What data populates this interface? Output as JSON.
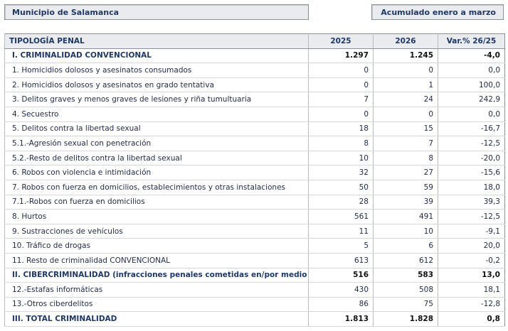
{
  "header": {
    "municipality": "Municipio de Salamanca",
    "period": "Acumulado enero a marzo"
  },
  "table": {
    "columns": [
      "TIPOLOGÍA PENAL",
      "2025",
      "2026",
      "Var.% 26/25"
    ],
    "rows": [
      {
        "label": "I. CRIMINALIDAD CONVENCIONAL",
        "y2025": "1.297",
        "y2026": "1.245",
        "var": "-4,0",
        "bold": true
      },
      {
        "label": "1. Homicidios dolosos y asesinatos consumados",
        "y2025": "0",
        "y2026": "0",
        "var": "0,0",
        "bold": false
      },
      {
        "label": "2. Homicidios dolosos y asesinatos en grado tentativa",
        "y2025": "0",
        "y2026": "1",
        "var": "100,0",
        "bold": false
      },
      {
        "label": "3. Delitos graves y menos graves de lesiones y riña tumultuaria",
        "y2025": "7",
        "y2026": "24",
        "var": "242,9",
        "bold": false
      },
      {
        "label": "4. Secuestro",
        "y2025": "0",
        "y2026": "0",
        "var": "0,0",
        "bold": false
      },
      {
        "label": "5. Delitos contra la libertad sexual",
        "y2025": "18",
        "y2026": "15",
        "var": "-16,7",
        "bold": false
      },
      {
        "label": "5.1.-Agresión sexual con penetración",
        "y2025": "8",
        "y2026": "7",
        "var": "-12,5",
        "bold": false
      },
      {
        "label": "5.2.-Resto de delitos contra la libertad sexual",
        "y2025": "10",
        "y2026": "8",
        "var": "-20,0",
        "bold": false
      },
      {
        "label": "6. Robos con violencia e intimidación",
        "y2025": "32",
        "y2026": "27",
        "var": "-15,6",
        "bold": false
      },
      {
        "label": "7. Robos con fuerza en domicilios, establecimientos y otras instalaciones",
        "y2025": "50",
        "y2026": "59",
        "var": "18,0",
        "bold": false
      },
      {
        "label": "7.1.-Robos con fuerza en domicilios",
        "y2025": "28",
        "y2026": "39",
        "var": "39,3",
        "bold": false
      },
      {
        "label": "8. Hurtos",
        "y2025": "561",
        "y2026": "491",
        "var": "-12,5",
        "bold": false
      },
      {
        "label": "9. Sustracciones de vehículos",
        "y2025": "11",
        "y2026": "10",
        "var": "-9,1",
        "bold": false
      },
      {
        "label": "10. Tráfico de drogas",
        "y2025": "5",
        "y2026": "6",
        "var": "20,0",
        "bold": false
      },
      {
        "label": "11. Resto de criminalidad CONVENCIONAL",
        "y2025": "613",
        "y2026": "612",
        "var": "-0,2",
        "bold": false
      },
      {
        "label": "II. CIBERCRIMINALIDAD (infracciones penales cometidas en/por medio ciber)",
        "y2025": "516",
        "y2026": "583",
        "var": "13,0",
        "bold": true
      },
      {
        "label": "12.-Estafas informáticas",
        "y2025": "430",
        "y2026": "508",
        "var": "18,1",
        "bold": false
      },
      {
        "label": "13.-Otros ciberdelitos",
        "y2025": "86",
        "y2026": "75",
        "var": "-12,8",
        "bold": false
      },
      {
        "label": "III. TOTAL CRIMINALIDAD",
        "y2025": "1.813",
        "y2026": "1.828",
        "var": "0,8",
        "bold": true
      }
    ]
  }
}
